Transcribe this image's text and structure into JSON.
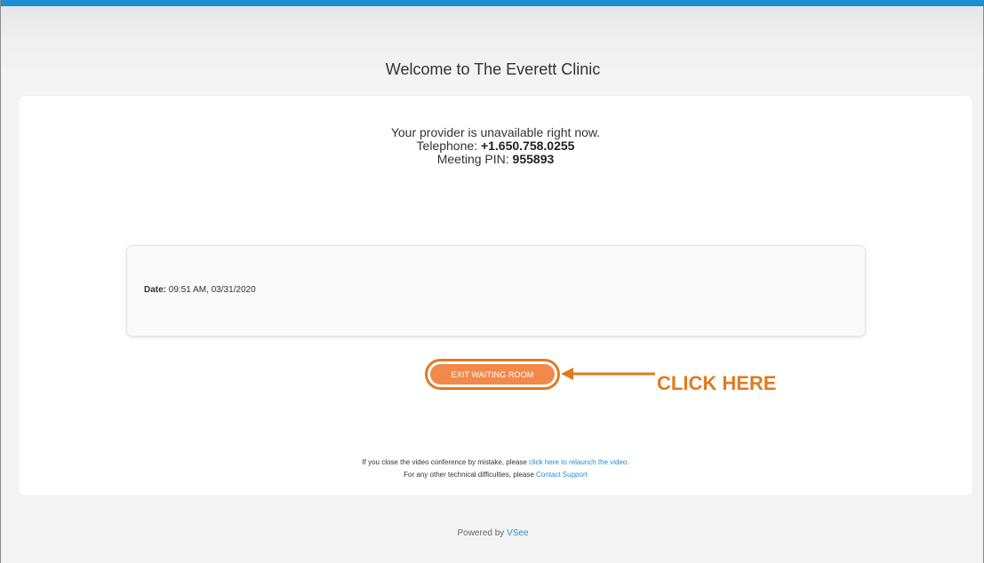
{
  "page": {
    "title": "Welcome to The Everett Clinic",
    "accent_color": "#1a8fd1",
    "callout_color": "#e07a20"
  },
  "status": {
    "message": "Your provider is unavailable right now.",
    "telephone_label": "Telephone:",
    "telephone_value": "+1.650.758.0255",
    "pin_label": "Meeting PIN:",
    "pin_value": "955893"
  },
  "visit": {
    "date_label": "Date:",
    "date_value": "09:51 AM, 03/31/2020"
  },
  "actions": {
    "exit_label": "EXIT WAITING ROOM",
    "callout_text": "CLICK HERE",
    "callout_icon": "left-arrow-icon"
  },
  "help": {
    "relaunch_prefix": "If you close the video conference by mistake, please",
    "relaunch_link": "click here to relaunch the video.",
    "support_prefix": "For any other technical difficulties, please",
    "support_link": "Contact Support"
  },
  "footer": {
    "powered_prefix": "Powered by",
    "powered_link": "VSee"
  }
}
